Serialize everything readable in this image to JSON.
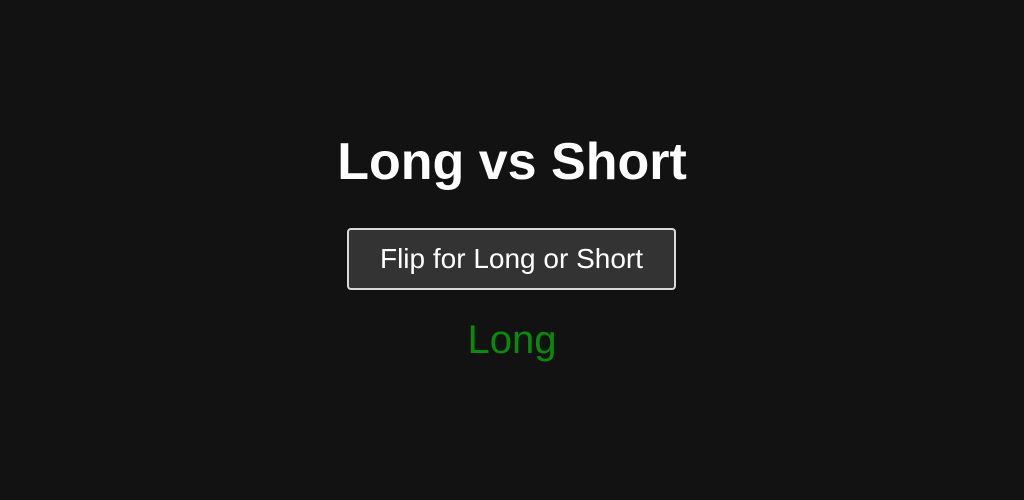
{
  "header": {
    "title": "Long vs Short"
  },
  "controls": {
    "flip_label": "Flip for Long or Short"
  },
  "result": {
    "text": "Long",
    "color": "#0a8a0a"
  },
  "theme": {
    "background": "#121212",
    "text": "#ffffff",
    "button_background": "#333333",
    "button_border": "#d9d9d9"
  }
}
